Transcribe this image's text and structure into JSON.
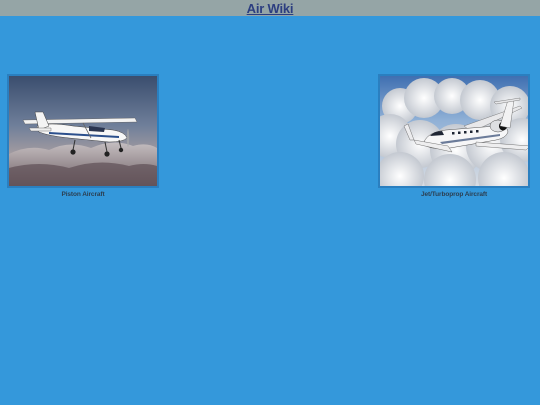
{
  "header": {
    "title": "Air Wiki"
  },
  "categories": [
    {
      "label": "Piston Aircraft",
      "icon": "piston-aircraft-photo"
    },
    {
      "label": "Jet/Turboprop Aircraft",
      "icon": "jet-aircraft-photo"
    }
  ],
  "colors": {
    "background": "#3498db",
    "header": "#95a5a6",
    "link": "#2c3e80",
    "caption": "#2c3e50"
  }
}
